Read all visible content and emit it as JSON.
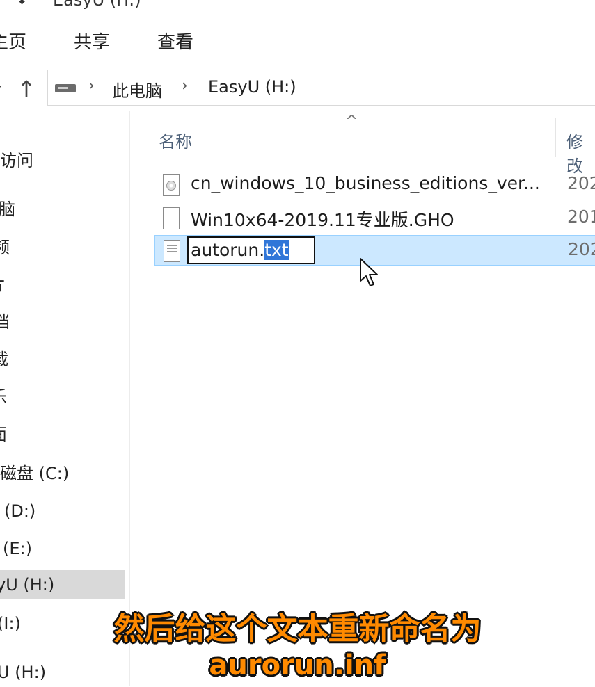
{
  "window": {
    "title": "EasyU (H:)"
  },
  "ribbon": {
    "tabs": [
      "主页",
      "共享",
      "查看"
    ]
  },
  "address": {
    "crumbs": [
      "此电脑",
      "EasyU (H:)"
    ]
  },
  "nav_pane": {
    "items": [
      {
        "label": "访问"
      },
      {
        "label": "脑"
      },
      {
        "label": "频"
      },
      {
        "label": "片"
      },
      {
        "label": "档"
      },
      {
        "label": "载"
      },
      {
        "label": "乐"
      },
      {
        "label": "面"
      },
      {
        "label": "磁盘 (C:)"
      },
      {
        "label": "(D:)"
      },
      {
        "label": "(E:)"
      },
      {
        "label": "yU (H:)",
        "selected": true
      },
      {
        "label": "(I:)"
      },
      {
        "label": "U (H:)"
      }
    ]
  },
  "list_header": {
    "name": "名称",
    "date": "修改"
  },
  "files": [
    {
      "name": "cn_windows_10_business_editions_ver...",
      "date": "202",
      "icon": "disc-image-file-icon"
    },
    {
      "name": "Win10x64-2019.11专业版.GHO",
      "date": "201",
      "icon": "blank-file-icon"
    },
    {
      "name": "autorun.txt",
      "date": "202",
      "icon": "text-file-icon",
      "selected": true,
      "renaming": true
    }
  ],
  "rename": {
    "base": "autorun.",
    "selected_ext": "txt"
  },
  "caption": {
    "line1": "然后给这个文本重新命名为",
    "line2": "aurorun.inf"
  },
  "colors": {
    "selection_bg": "#cce8ff",
    "selection_border": "#99d1ff",
    "caption": "#ff8a00",
    "text_highlight": "#3076d8"
  }
}
